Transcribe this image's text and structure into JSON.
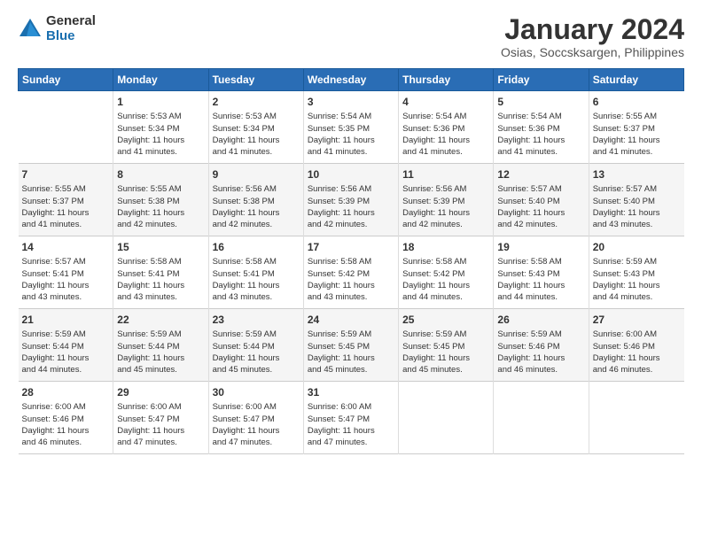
{
  "logo": {
    "general": "General",
    "blue": "Blue"
  },
  "title": "January 2024",
  "subtitle": "Osias, Soccsksargen, Philippines",
  "days_header": [
    "Sunday",
    "Monday",
    "Tuesday",
    "Wednesday",
    "Thursday",
    "Friday",
    "Saturday"
  ],
  "weeks": [
    [
      {
        "num": "",
        "sunrise": "",
        "sunset": "",
        "daylight": ""
      },
      {
        "num": "1",
        "sunrise": "Sunrise: 5:53 AM",
        "sunset": "Sunset: 5:34 PM",
        "daylight": "Daylight: 11 hours and 41 minutes."
      },
      {
        "num": "2",
        "sunrise": "Sunrise: 5:53 AM",
        "sunset": "Sunset: 5:34 PM",
        "daylight": "Daylight: 11 hours and 41 minutes."
      },
      {
        "num": "3",
        "sunrise": "Sunrise: 5:54 AM",
        "sunset": "Sunset: 5:35 PM",
        "daylight": "Daylight: 11 hours and 41 minutes."
      },
      {
        "num": "4",
        "sunrise": "Sunrise: 5:54 AM",
        "sunset": "Sunset: 5:36 PM",
        "daylight": "Daylight: 11 hours and 41 minutes."
      },
      {
        "num": "5",
        "sunrise": "Sunrise: 5:54 AM",
        "sunset": "Sunset: 5:36 PM",
        "daylight": "Daylight: 11 hours and 41 minutes."
      },
      {
        "num": "6",
        "sunrise": "Sunrise: 5:55 AM",
        "sunset": "Sunset: 5:37 PM",
        "daylight": "Daylight: 11 hours and 41 minutes."
      }
    ],
    [
      {
        "num": "7",
        "sunrise": "Sunrise: 5:55 AM",
        "sunset": "Sunset: 5:37 PM",
        "daylight": "Daylight: 11 hours and 41 minutes."
      },
      {
        "num": "8",
        "sunrise": "Sunrise: 5:55 AM",
        "sunset": "Sunset: 5:38 PM",
        "daylight": "Daylight: 11 hours and 42 minutes."
      },
      {
        "num": "9",
        "sunrise": "Sunrise: 5:56 AM",
        "sunset": "Sunset: 5:38 PM",
        "daylight": "Daylight: 11 hours and 42 minutes."
      },
      {
        "num": "10",
        "sunrise": "Sunrise: 5:56 AM",
        "sunset": "Sunset: 5:39 PM",
        "daylight": "Daylight: 11 hours and 42 minutes."
      },
      {
        "num": "11",
        "sunrise": "Sunrise: 5:56 AM",
        "sunset": "Sunset: 5:39 PM",
        "daylight": "Daylight: 11 hours and 42 minutes."
      },
      {
        "num": "12",
        "sunrise": "Sunrise: 5:57 AM",
        "sunset": "Sunset: 5:40 PM",
        "daylight": "Daylight: 11 hours and 42 minutes."
      },
      {
        "num": "13",
        "sunrise": "Sunrise: 5:57 AM",
        "sunset": "Sunset: 5:40 PM",
        "daylight": "Daylight: 11 hours and 43 minutes."
      }
    ],
    [
      {
        "num": "14",
        "sunrise": "Sunrise: 5:57 AM",
        "sunset": "Sunset: 5:41 PM",
        "daylight": "Daylight: 11 hours and 43 minutes."
      },
      {
        "num": "15",
        "sunrise": "Sunrise: 5:58 AM",
        "sunset": "Sunset: 5:41 PM",
        "daylight": "Daylight: 11 hours and 43 minutes."
      },
      {
        "num": "16",
        "sunrise": "Sunrise: 5:58 AM",
        "sunset": "Sunset: 5:41 PM",
        "daylight": "Daylight: 11 hours and 43 minutes."
      },
      {
        "num": "17",
        "sunrise": "Sunrise: 5:58 AM",
        "sunset": "Sunset: 5:42 PM",
        "daylight": "Daylight: 11 hours and 43 minutes."
      },
      {
        "num": "18",
        "sunrise": "Sunrise: 5:58 AM",
        "sunset": "Sunset: 5:42 PM",
        "daylight": "Daylight: 11 hours and 44 minutes."
      },
      {
        "num": "19",
        "sunrise": "Sunrise: 5:58 AM",
        "sunset": "Sunset: 5:43 PM",
        "daylight": "Daylight: 11 hours and 44 minutes."
      },
      {
        "num": "20",
        "sunrise": "Sunrise: 5:59 AM",
        "sunset": "Sunset: 5:43 PM",
        "daylight": "Daylight: 11 hours and 44 minutes."
      }
    ],
    [
      {
        "num": "21",
        "sunrise": "Sunrise: 5:59 AM",
        "sunset": "Sunset: 5:44 PM",
        "daylight": "Daylight: 11 hours and 44 minutes."
      },
      {
        "num": "22",
        "sunrise": "Sunrise: 5:59 AM",
        "sunset": "Sunset: 5:44 PM",
        "daylight": "Daylight: 11 hours and 45 minutes."
      },
      {
        "num": "23",
        "sunrise": "Sunrise: 5:59 AM",
        "sunset": "Sunset: 5:44 PM",
        "daylight": "Daylight: 11 hours and 45 minutes."
      },
      {
        "num": "24",
        "sunrise": "Sunrise: 5:59 AM",
        "sunset": "Sunset: 5:45 PM",
        "daylight": "Daylight: 11 hours and 45 minutes."
      },
      {
        "num": "25",
        "sunrise": "Sunrise: 5:59 AM",
        "sunset": "Sunset: 5:45 PM",
        "daylight": "Daylight: 11 hours and 45 minutes."
      },
      {
        "num": "26",
        "sunrise": "Sunrise: 5:59 AM",
        "sunset": "Sunset: 5:46 PM",
        "daylight": "Daylight: 11 hours and 46 minutes."
      },
      {
        "num": "27",
        "sunrise": "Sunrise: 6:00 AM",
        "sunset": "Sunset: 5:46 PM",
        "daylight": "Daylight: 11 hours and 46 minutes."
      }
    ],
    [
      {
        "num": "28",
        "sunrise": "Sunrise: 6:00 AM",
        "sunset": "Sunset: 5:46 PM",
        "daylight": "Daylight: 11 hours and 46 minutes."
      },
      {
        "num": "29",
        "sunrise": "Sunrise: 6:00 AM",
        "sunset": "Sunset: 5:47 PM",
        "daylight": "Daylight: 11 hours and 47 minutes."
      },
      {
        "num": "30",
        "sunrise": "Sunrise: 6:00 AM",
        "sunset": "Sunset: 5:47 PM",
        "daylight": "Daylight: 11 hours and 47 minutes."
      },
      {
        "num": "31",
        "sunrise": "Sunrise: 6:00 AM",
        "sunset": "Sunset: 5:47 PM",
        "daylight": "Daylight: 11 hours and 47 minutes."
      },
      {
        "num": "",
        "sunrise": "",
        "sunset": "",
        "daylight": ""
      },
      {
        "num": "",
        "sunrise": "",
        "sunset": "",
        "daylight": ""
      },
      {
        "num": "",
        "sunrise": "",
        "sunset": "",
        "daylight": ""
      }
    ]
  ]
}
